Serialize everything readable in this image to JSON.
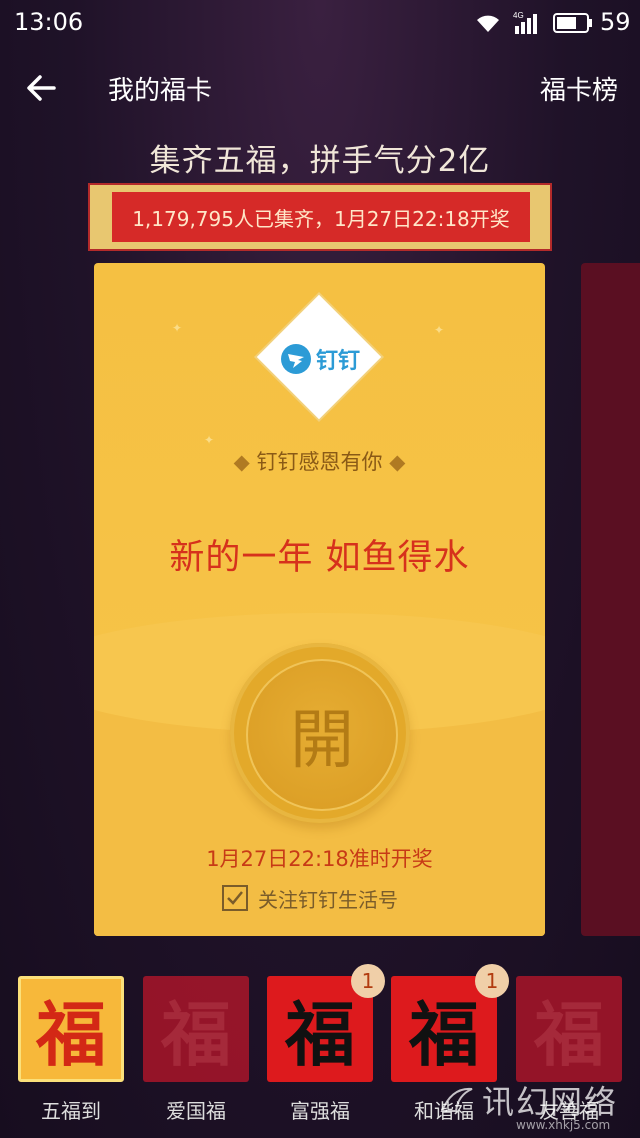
{
  "status_bar": {
    "time": "13:06",
    "network": "4G",
    "battery": "59"
  },
  "header": {
    "title": "我的福卡",
    "rank_link": "福卡榜"
  },
  "headline": "集齐五福，拼手气分2亿",
  "banner": "1,179,795人已集齐，1月27日22:18开奖",
  "card": {
    "brand": "钉钉",
    "thanks": "钉钉感恩有你",
    "slogan": "新的一年 如鱼得水",
    "open_button": "開",
    "open_time": "1月27日22:18准时开奖",
    "follow_label": "关注钉钉生活号",
    "follow_checked": true
  },
  "fu_cards": [
    {
      "label": "五福到",
      "glyph": "福",
      "badge": ""
    },
    {
      "label": "爱国福",
      "glyph": "福",
      "badge": ""
    },
    {
      "label": "富强福",
      "glyph": "福",
      "badge": "1"
    },
    {
      "label": "和谐福",
      "glyph": "福",
      "badge": "1"
    },
    {
      "label": "友善福",
      "glyph": "福",
      "badge": ""
    }
  ],
  "watermark": {
    "text": "讯幻网络",
    "url": "www.xhkj5.com"
  },
  "colors": {
    "accent_red": "#d62a28",
    "gold": "#f5c042",
    "background": "#1f1228"
  }
}
